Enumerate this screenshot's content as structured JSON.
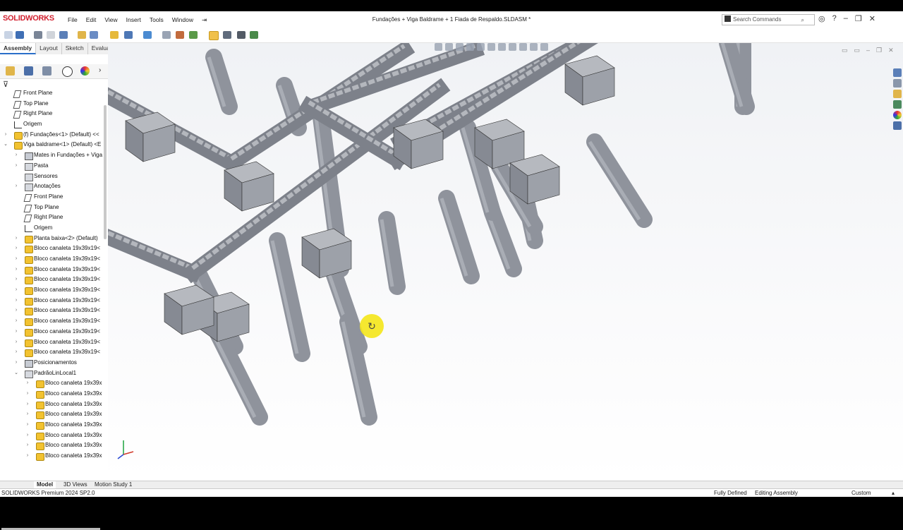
{
  "app": {
    "logo": "SOLIDWORKS",
    "menu": [
      "File",
      "Edit",
      "View",
      "Insert",
      "Tools",
      "Window"
    ],
    "document_title": "Fundações + Viga Baldrame + 1 Fiada de Respaldo.SLDASM *",
    "search_placeholder": "Search Commands"
  },
  "command_tabs": [
    {
      "label": "Assembly",
      "active": true
    },
    {
      "label": "Layout",
      "active": false
    },
    {
      "label": "Sketch",
      "active": false
    },
    {
      "label": "Evaluate",
      "active": false
    }
  ],
  "tree": [
    {
      "label": "Front Plane",
      "type": "plane",
      "level": 0,
      "arrow": ""
    },
    {
      "label": "Top Plane",
      "type": "plane",
      "level": 0,
      "arrow": ""
    },
    {
      "label": "Right Plane",
      "type": "plane",
      "level": 0,
      "arrow": ""
    },
    {
      "label": "Origem",
      "type": "origin",
      "level": 0,
      "arrow": ""
    },
    {
      "label": "(f) Fundações<1> (Default) <<",
      "type": "part",
      "level": 0,
      "arrow": "›"
    },
    {
      "label": "Viga baldrame<1> (Default) <E",
      "type": "part",
      "level": 0,
      "arrow": "⌄"
    },
    {
      "label": "Mates in Fundações + Viga",
      "type": "mates",
      "level": 1,
      "arrow": "›"
    },
    {
      "label": "Pasta",
      "type": "folder",
      "level": 1,
      "arrow": "›"
    },
    {
      "label": "Sensores",
      "type": "folder",
      "level": 1,
      "arrow": ""
    },
    {
      "label": "Anotações",
      "type": "folder",
      "level": 1,
      "arrow": "›"
    },
    {
      "label": "Front Plane",
      "type": "plane",
      "level": 1,
      "arrow": ""
    },
    {
      "label": "Top Plane",
      "type": "plane",
      "level": 1,
      "arrow": ""
    },
    {
      "label": "Right Plane",
      "type": "plane",
      "level": 1,
      "arrow": ""
    },
    {
      "label": "Origem",
      "type": "origin",
      "level": 1,
      "arrow": ""
    },
    {
      "label": "Planta baixa<2> (Default)",
      "type": "part",
      "level": 1,
      "arrow": "›"
    },
    {
      "label": "Bloco canaleta 19x39x19<",
      "type": "part",
      "level": 1,
      "arrow": "›"
    },
    {
      "label": "Bloco canaleta 19x39x19<",
      "type": "part",
      "level": 1,
      "arrow": "›"
    },
    {
      "label": "Bloco canaleta 19x39x19<",
      "type": "part",
      "level": 1,
      "arrow": "›"
    },
    {
      "label": "Bloco canaleta 19x39x19<",
      "type": "part",
      "level": 1,
      "arrow": "›"
    },
    {
      "label": "Bloco canaleta 19x39x19<",
      "type": "part",
      "level": 1,
      "arrow": "›"
    },
    {
      "label": "Bloco canaleta 19x39x19<",
      "type": "part",
      "level": 1,
      "arrow": "›"
    },
    {
      "label": "Bloco canaleta 19x39x19<",
      "type": "part",
      "level": 1,
      "arrow": "›"
    },
    {
      "label": "Bloco canaleta 19x39x19<",
      "type": "part",
      "level": 1,
      "arrow": "›"
    },
    {
      "label": "Bloco canaleta 19x39x19<",
      "type": "part",
      "level": 1,
      "arrow": "›"
    },
    {
      "label": "Bloco canaleta 19x39x19<",
      "type": "part",
      "level": 1,
      "arrow": "›"
    },
    {
      "label": "Bloco canaleta 19x39x19<",
      "type": "part",
      "level": 1,
      "arrow": "›"
    },
    {
      "label": "Posicionamentos",
      "type": "mates",
      "level": 1,
      "arrow": "›"
    },
    {
      "label": "PadrãoLinLocal1",
      "type": "folder",
      "level": 1,
      "arrow": "⌄"
    },
    {
      "label": "Bloco canaleta 19x39x",
      "type": "part",
      "level": 2,
      "arrow": "›"
    },
    {
      "label": "Bloco canaleta 19x39x",
      "type": "part",
      "level": 2,
      "arrow": "›"
    },
    {
      "label": "Bloco canaleta 19x39x",
      "type": "part",
      "level": 2,
      "arrow": "›"
    },
    {
      "label": "Bloco canaleta 19x39x",
      "type": "part",
      "level": 2,
      "arrow": "›"
    },
    {
      "label": "Bloco canaleta 19x39x",
      "type": "part",
      "level": 2,
      "arrow": "›"
    },
    {
      "label": "Bloco canaleta 19x39x",
      "type": "part",
      "level": 2,
      "arrow": "›"
    },
    {
      "label": "Bloco canaleta 19x39x",
      "type": "part",
      "level": 2,
      "arrow": "›"
    },
    {
      "label": "Bloco canaleta 19x39x",
      "type": "part",
      "level": 2,
      "arrow": "›"
    }
  ],
  "bottom_tabs": [
    {
      "label": "Model",
      "active": true
    },
    {
      "label": "3D Views",
      "active": false
    },
    {
      "label": "Motion Study 1",
      "active": false
    }
  ],
  "status": {
    "version": "SOLIDWORKS Premium 2024 SP2.0",
    "defined": "Fully Defined",
    "mode": "Editing Assembly",
    "units": "Custom"
  },
  "colors": {
    "accent": "#2a6fc9",
    "logo": "#d2202f",
    "model_gray": "#8f939c",
    "cursor_highlight": "#f5e71a"
  },
  "icons": {
    "cursor": "rotate-cursor-icon"
  }
}
